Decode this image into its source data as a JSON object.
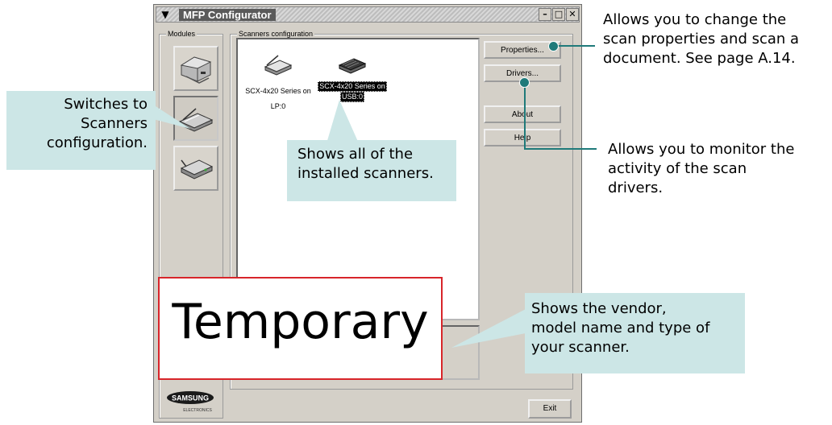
{
  "window": {
    "title": "MFP Configurator",
    "modules_label": "Modules",
    "scanners_config_label": "Scanners configuration"
  },
  "modules": [
    {
      "name": "printer-module",
      "icon": "printer-icon",
      "active": false
    },
    {
      "name": "scanner-module",
      "icon": "scanner-icon",
      "active": true
    },
    {
      "name": "port-module",
      "icon": "port-icon",
      "active": false
    }
  ],
  "scanners": [
    {
      "label_line1": "SCX-4x20 Series on",
      "label_line2": "LP:0",
      "selected": false
    },
    {
      "label_line1": "SCX-4x20 Series on",
      "label_line2": "USB:0",
      "selected": true
    }
  ],
  "buttons": {
    "properties": "Properties...",
    "drivers": "Drivers...",
    "about": "About",
    "help": "Help",
    "exit": "Exit"
  },
  "logo": {
    "brand": "SAMSUNG",
    "sub": "ELECTRONICS"
  },
  "annotations": {
    "switches_line1": "Switches to",
    "switches_line2": "Scanners",
    "switches_line3": "configuration.",
    "shows_all_line1": "Shows all of the",
    "shows_all_line2": "installed scanners.",
    "properties_line1": "Allows you to change the",
    "properties_line2": "scan properties and scan a",
    "properties_line3": "document. See page A.14.",
    "drivers_line1": "Allows you to monitor the",
    "drivers_line2": "activity of the scan",
    "drivers_line3": "drivers.",
    "vendor_line1": "Shows the vendor,",
    "vendor_line2": "model name and type of",
    "vendor_line3": "your scanner."
  },
  "overlay": {
    "text": "Temporary"
  },
  "colors": {
    "callout_bg": "#cce6e6",
    "connector": "#1f7a7a",
    "overlay_border": "#d8252a"
  }
}
